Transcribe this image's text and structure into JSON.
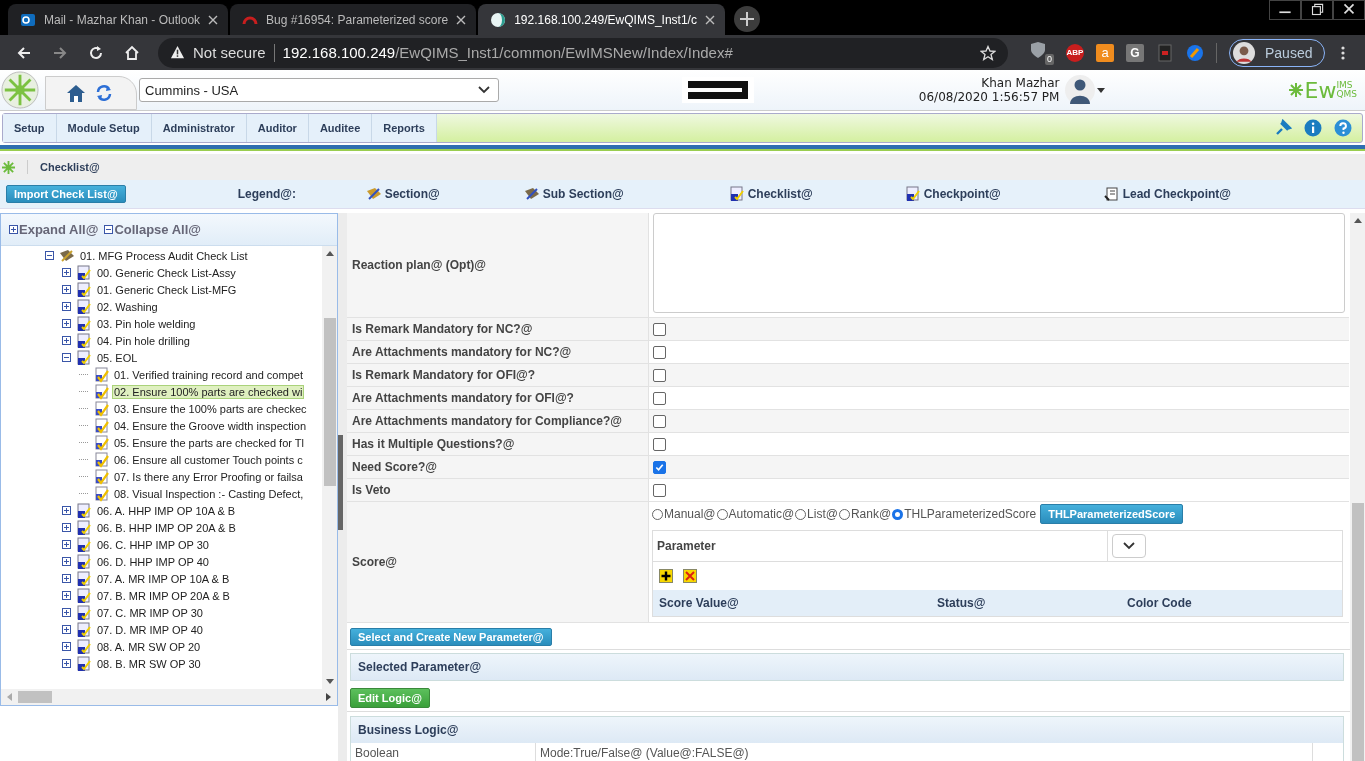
{
  "browser": {
    "tabs": [
      {
        "title": "Mail - Mazhar Khan - Outlook",
        "kind": "mail",
        "selected": false
      },
      {
        "title": "Bug #16954: Parameterized score",
        "kind": "bug",
        "selected": false
      },
      {
        "title": "192.168.100.249/EwQIMS_Inst1/c",
        "kind": "site",
        "selected": true
      }
    ],
    "address": {
      "security": "Not secure",
      "host": "192.168.100.249",
      "path": "/EwQIMS_Inst1/common/EwIMSNew/Index/Index#"
    },
    "extensions": [
      {
        "kind": "shield",
        "label": "0"
      },
      {
        "kind": "abp",
        "label": "ABP"
      },
      {
        "kind": "shop",
        "label": "a"
      },
      {
        "kind": "letter",
        "label": "G"
      },
      {
        "kind": "doc"
      },
      {
        "kind": "brush"
      }
    ],
    "profile": "Paused"
  },
  "header": {
    "company": "Cummins - USA",
    "user": "Khan Mazhar",
    "datetime": "06/08/2020 1:56:57 PM",
    "logo": {
      "main": "Ew",
      "top": "IMS",
      "bottom": "QMS"
    }
  },
  "menu": [
    "Setup",
    "Module Setup",
    "Administrator",
    "Auditor",
    "Auditee",
    "Reports"
  ],
  "breadcrumb": "Checklist@",
  "toolbar": {
    "import_button": "Import Check List@",
    "legend_label": "Legend@:",
    "legend": [
      {
        "kind": "section",
        "label": "Section@"
      },
      {
        "kind": "subsection",
        "label": "Sub Section@"
      },
      {
        "kind": "checklist",
        "label": "Checklist@"
      },
      {
        "kind": "checkpoint",
        "label": "Checkpoint@"
      },
      {
        "kind": "lead",
        "label": "Lead Checkpoint@"
      }
    ]
  },
  "tree_panel": {
    "expand_all": "Expand All@",
    "collapse_all": "Collapse All@",
    "tree": [
      {
        "label": "01. MFG Process Audit Check List",
        "kind": "subsection",
        "expanded": true,
        "selected": false,
        "children": [
          {
            "label": "00. Generic Check List-Assy",
            "kind": "checklist",
            "expanded": false,
            "selected": false
          },
          {
            "label": "01. Generic Check List-MFG",
            "kind": "checklist",
            "expanded": false,
            "selected": false
          },
          {
            "label": "02. Washing",
            "kind": "checklist",
            "expanded": false,
            "selected": false
          },
          {
            "label": "03. Pin hole welding",
            "kind": "checklist",
            "expanded": false,
            "selected": false
          },
          {
            "label": "04. Pin hole drilling",
            "kind": "checklist",
            "expanded": false,
            "selected": false
          },
          {
            "label": "05. EOL",
            "kind": "checklist",
            "expanded": true,
            "selected": false,
            "children": [
              {
                "label": "01. Verified training record and compet",
                "kind": "checkpoint",
                "selected": false
              },
              {
                "label": "02. Ensure 100% parts are checked wi",
                "kind": "checkpoint",
                "selected": true
              },
              {
                "label": "03. Ensure the 100% parts are checkec",
                "kind": "checkpoint",
                "selected": false
              },
              {
                "label": "04. Ensure the Groove width inspection",
                "kind": "checkpoint",
                "selected": false
              },
              {
                "label": "05. Ensure the parts are checked for Tl",
                "kind": "checkpoint",
                "selected": false
              },
              {
                "label": "06. Ensure all customer Touch points c",
                "kind": "checkpoint",
                "selected": false
              },
              {
                "label": "07. Is there any Error Proofing or failsa",
                "kind": "checkpoint",
                "selected": false
              },
              {
                "label": "08. Visual Inspection :- Casting Defect,",
                "kind": "checkpoint",
                "selected": false
              }
            ]
          },
          {
            "label": "06. A. HHP IMP OP 10A & B",
            "kind": "checklist",
            "expanded": false,
            "selected": false
          },
          {
            "label": "06. B. HHP IMP OP 20A & B",
            "kind": "checklist",
            "expanded": false,
            "selected": false
          },
          {
            "label": "06. C. HHP IMP OP 30",
            "kind": "checklist",
            "expanded": false,
            "selected": false
          },
          {
            "label": "06. D. HHP IMP OP 40",
            "kind": "checklist",
            "expanded": false,
            "selected": false
          },
          {
            "label": "07. A. MR IMP OP 10A & B",
            "kind": "checklist",
            "expanded": false,
            "selected": false
          },
          {
            "label": "07. B. MR IMP OP 20A & B",
            "kind": "checklist",
            "expanded": false,
            "selected": false
          },
          {
            "label": "07. C. MR IMP OP 30",
            "kind": "checklist",
            "expanded": false,
            "selected": false
          },
          {
            "label": "07. D. MR IMP OP 40",
            "kind": "checklist",
            "expanded": false,
            "selected": false
          },
          {
            "label": "08. A. MR SW OP 20",
            "kind": "checklist",
            "expanded": false,
            "selected": false
          },
          {
            "label": "08. B. MR SW OP 30",
            "kind": "checklist",
            "expanded": false,
            "selected": false
          }
        ]
      }
    ]
  },
  "form": {
    "reaction_plan_label": "Reaction plan@ (Opt)@",
    "options": [
      {
        "label": "Is Remark Mandatory for NC?@",
        "checked": false
      },
      {
        "label": "Are Attachments mandatory for NC?@",
        "checked": false
      },
      {
        "label": "Is Remark Mandatory for OFI@?",
        "checked": false
      },
      {
        "label": "Are Attachments mandatory for OFI@?",
        "checked": false
      },
      {
        "label": "Are Attachments mandatory for Compliance?@",
        "checked": false
      },
      {
        "label": "Has it Multiple Questions?@",
        "checked": false
      },
      {
        "label": "Need Score?@",
        "checked": true
      },
      {
        "label": "Is Veto",
        "checked": false
      }
    ],
    "score_label": "Score@",
    "score_types": [
      {
        "label": "Manual@",
        "selected": false
      },
      {
        "label": "Automatic@",
        "selected": false
      },
      {
        "label": "List@",
        "selected": false
      },
      {
        "label": "Rank@",
        "selected": false
      },
      {
        "label": "THLParameterizedScore",
        "selected": true
      }
    ],
    "score_button": "THLParameterizedScore",
    "parameter_label": "Parameter",
    "score_columns": [
      "Score Value@",
      "Status@",
      "Color Code"
    ],
    "create_button": "Select and Create New Parameter@",
    "selected_parameter": "Selected Parameter@",
    "edit_logic_button": "Edit Logic@",
    "business_logic": {
      "title": "Business Logic@",
      "row": [
        "Boolean",
        "Mode:True/False@ (Value@:FALSE@)"
      ]
    }
  }
}
